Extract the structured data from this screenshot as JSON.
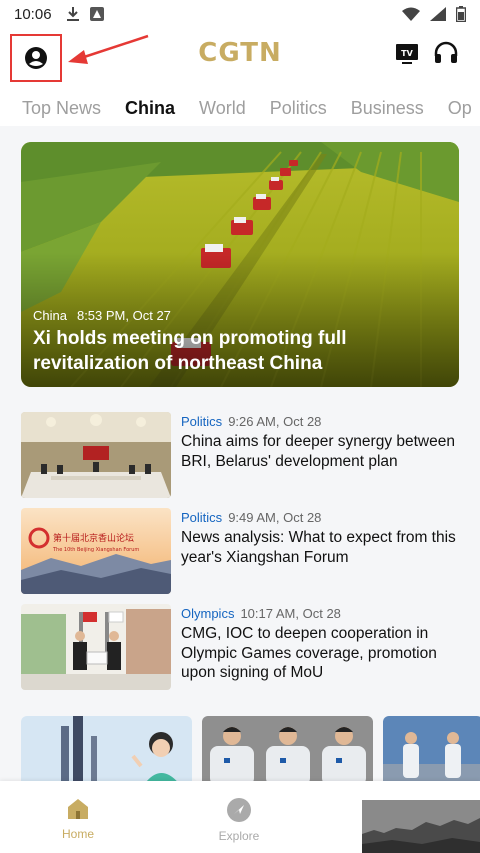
{
  "status_bar": {
    "time": "10:06"
  },
  "header": {
    "logo": "CGTN",
    "tv_label": "TV"
  },
  "tabs": [
    {
      "label": "Top News",
      "active": false
    },
    {
      "label": "China",
      "active": true
    },
    {
      "label": "World",
      "active": false
    },
    {
      "label": "Politics",
      "active": false
    },
    {
      "label": "Business",
      "active": false
    },
    {
      "label": "Op",
      "active": false
    }
  ],
  "hero": {
    "category": "China",
    "time": "8:53 PM, Oct 27",
    "title": "Xi holds meeting on promoting full revitalization of northeast China"
  },
  "news": [
    {
      "category": "Politics",
      "time": "9:26 AM, Oct 28",
      "title": "China aims for deeper synergy between BRI, Belarus' development plan"
    },
    {
      "category": "Politics",
      "time": "9:49 AM, Oct 28",
      "title": "News analysis: What to expect from this year's Xiangshan Forum",
      "thumb_caption": "第十届北京香山论坛",
      "thumb_caption_en": "The 10th Beijing Xiangshan Forum"
    },
    {
      "category": "Olympics",
      "time": "10:17 AM, Oct 28",
      "title": "CMG, IOC to deepen cooperation in Olympic Games coverage, promotion upon signing of MoU"
    }
  ],
  "bottom_nav": {
    "home": "Home",
    "explore": "Explore"
  },
  "colors": {
    "brand_gold": "#c8ac62",
    "category_blue": "#1565c0",
    "highlight_red": "#e53935"
  }
}
